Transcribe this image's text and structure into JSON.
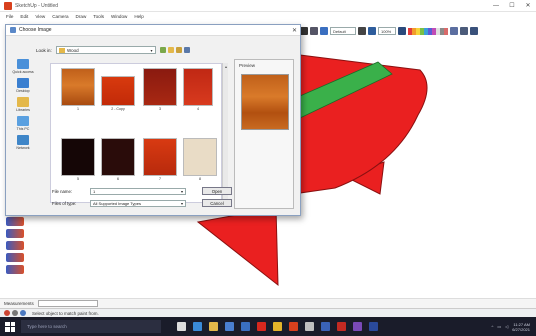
{
  "window": {
    "title": "SketchUp - Untitled",
    "minimize": "—",
    "maximize": "☐",
    "close": "✕"
  },
  "menu": [
    "File",
    "Edit",
    "View",
    "Camera",
    "Draw",
    "Tools",
    "Window",
    "Help"
  ],
  "toolbar": {
    "style_box": "Default",
    "zoom_box": "100%"
  },
  "dialog": {
    "title": "Choose Image",
    "look_in_label": "Look in:",
    "look_in_value": "Wood",
    "places": [
      "Quick access",
      "Desktop",
      "Libraries",
      "This PC",
      "Network"
    ],
    "thumbnails": [
      {
        "caption": "1"
      },
      {
        "caption": "2 - Copy"
      },
      {
        "caption": "3"
      },
      {
        "caption": "4"
      },
      {
        "caption": "5"
      },
      {
        "caption": "6"
      },
      {
        "caption": "7"
      },
      {
        "caption": "8"
      }
    ],
    "preview_label": "Preview",
    "file_name_label": "File name:",
    "file_name_value": "1",
    "files_type_label": "Files of type:",
    "files_type_value": "All Supported Image Types",
    "open_button": "Open",
    "cancel_button": "Cancel"
  },
  "measurements": {
    "label": "Measurements"
  },
  "status": {
    "text": "Select object to match paint from."
  },
  "taskbar": {
    "search_placeholder": "Type here to search",
    "time": "11:27 AM",
    "date": "6/27/2021"
  },
  "colors": {
    "shape_red": "#ea2020",
    "shape_stroke": "#8a1010",
    "stripe_green": "#3ab04a",
    "taskbar": "#1a1c2a"
  }
}
